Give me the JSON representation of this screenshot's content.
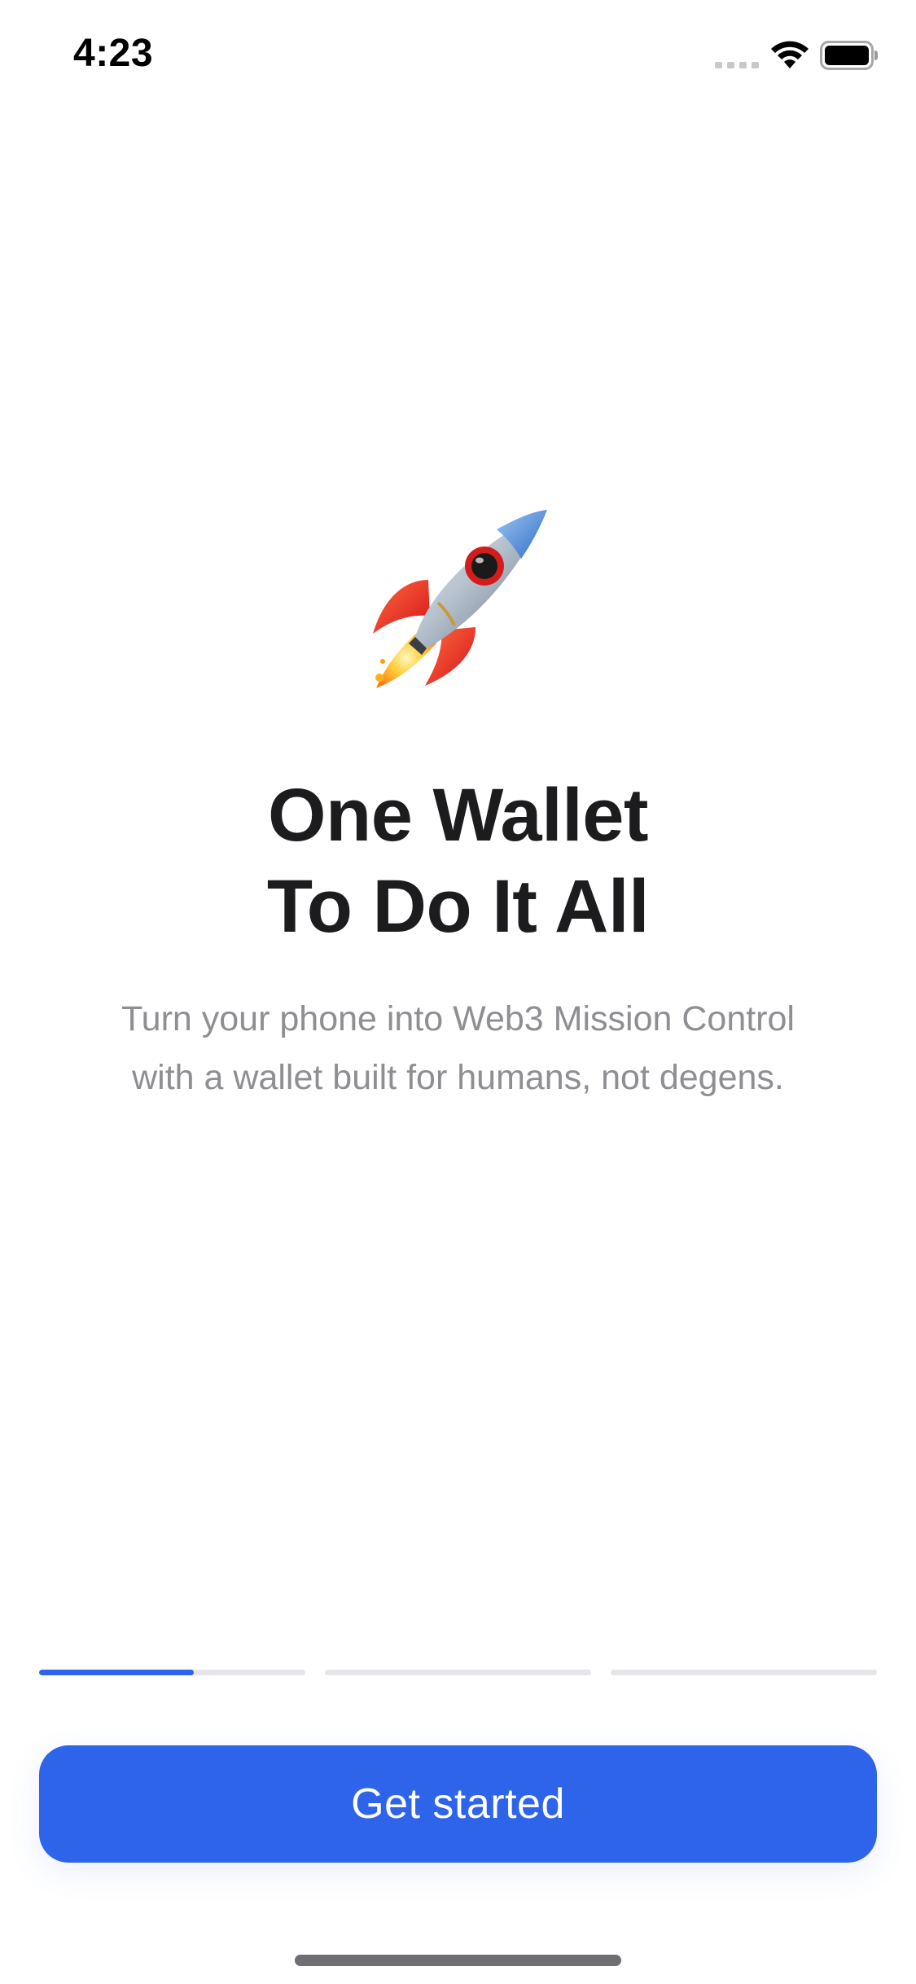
{
  "status_bar": {
    "time": "4:23"
  },
  "onboarding": {
    "hero_icon": "rocket-icon",
    "title_lines": [
      "One Wallet",
      "To Do It All"
    ],
    "subtitle_lines": [
      "Turn your phone into Web3 Mission Control",
      "with a wallet built for humans, not degens."
    ],
    "progress": {
      "steps": 3,
      "current_step": 1,
      "current_step_fill": 0.58
    },
    "cta_label": "Get started"
  },
  "colors": {
    "accent": "#2E64EA",
    "title": "#1C1C1E",
    "subtitle": "#8E8E93",
    "track": "#E5E5EA"
  }
}
